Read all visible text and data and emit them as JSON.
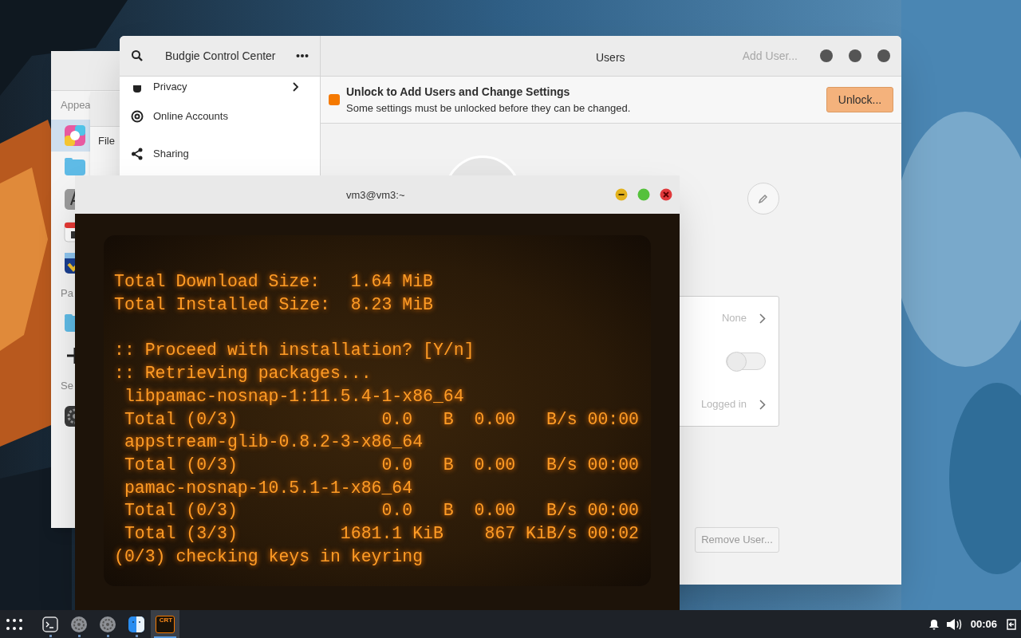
{
  "back_window": {
    "sections": [
      {
        "label": "Appea"
      },
      {
        "label": "Pa"
      },
      {
        "label": "Se"
      }
    ],
    "items": [
      {
        "kind": "colors",
        "selected": true
      },
      {
        "kind": "folder",
        "selected": false
      },
      {
        "kind": "font",
        "selected": false
      },
      {
        "kind": "calendar",
        "selected": false
      },
      {
        "kind": "check",
        "selected": false
      },
      {
        "kind": "folder",
        "selected": false
      },
      {
        "kind": "add",
        "selected": false
      },
      {
        "kind": "gear",
        "selected": false
      }
    ]
  },
  "file_window": {
    "menu": "File"
  },
  "control_center": {
    "title": "Budgie Control Center",
    "sidebar": {
      "items": [
        {
          "kind": "privacy",
          "label": "Privacy",
          "selected": false
        },
        {
          "kind": "online",
          "label": "Online Accounts",
          "selected": false
        },
        {
          "kind": "sharing",
          "label": "Sharing",
          "selected": false
        }
      ]
    },
    "page_title": "Users",
    "add_user": {
      "label": "Add User...",
      "disabled": true
    },
    "infobar": {
      "title": "Unlock to Add Users and Change Settings",
      "message": "Some settings must be unlocked before they can be changed.",
      "button": "Unlock..."
    },
    "account_rows": [
      {
        "kind": "link",
        "value": "None"
      },
      {
        "kind": "switch",
        "on": false
      },
      {
        "kind": "link",
        "value": "Logged in"
      }
    ],
    "remove_user": {
      "label": "Remove User...",
      "disabled": true
    }
  },
  "terminal": {
    "title": "vm3@vm3:~",
    "blocks": [
      [
        "Total Download Size:   1.64 MiB",
        "Total Installed Size:  8.23 MiB"
      ],
      [
        ":: Proceed with installation? [Y/n]",
        ":: Retrieving packages...",
        " libpamac-nosnap-1:11.5.4-1-x86_64",
        " Total (0/3)              0.0   B  0.00   B/s 00:00",
        " appstream-glib-0.8.2-3-x86_64",
        " Total (0/3)              0.0   B  0.00   B/s 00:00",
        " pamac-nosnap-10.5.1-1-x86_64",
        " Total (0/3)              0.0   B  0.00   B/s 00:00",
        " Total (3/3)          1681.1 KiB    867 KiB/s 00:02",
        "(0/3) checking keys in keyring"
      ]
    ]
  },
  "taskbar": {
    "apps": [
      {
        "kind": "terminal",
        "active": false
      },
      {
        "kind": "settings",
        "active": false
      },
      {
        "kind": "settings",
        "active": false
      },
      {
        "kind": "finder",
        "active": false
      },
      {
        "kind": "crt",
        "label": "CRT",
        "active": true
      }
    ],
    "clock": "00:06"
  }
}
